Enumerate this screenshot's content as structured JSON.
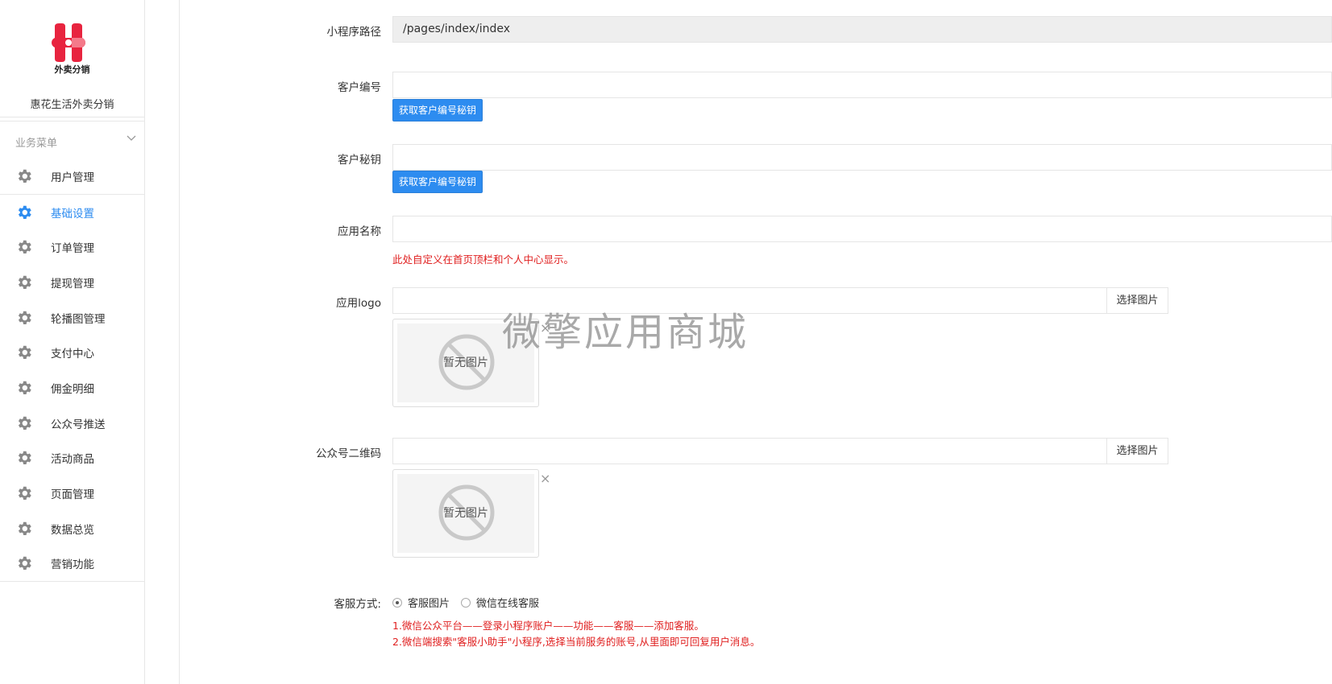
{
  "brand": {
    "logo_text": "外卖分销",
    "name": "惠花生活外卖分销",
    "logo_colors": [
      "#e8243f",
      "#f47a8a"
    ]
  },
  "menu": {
    "heading": "业务菜单",
    "items": [
      {
        "label": "用户管理",
        "icon": "gear-icon",
        "active": false
      },
      {
        "label": "基础设置",
        "icon": "gear-icon",
        "active": true
      },
      {
        "label": "订单管理",
        "icon": "gear-icon",
        "active": false
      },
      {
        "label": "提现管理",
        "icon": "gear-icon",
        "active": false
      },
      {
        "label": "轮播图管理",
        "icon": "gear-icon",
        "active": false
      },
      {
        "label": "支付中心",
        "icon": "gear-icon",
        "active": false
      },
      {
        "label": "佣金明细",
        "icon": "gear-icon",
        "active": false
      },
      {
        "label": "公众号推送",
        "icon": "gear-icon",
        "active": false
      },
      {
        "label": "活动商品",
        "icon": "gear-icon",
        "active": false
      },
      {
        "label": "页面管理",
        "icon": "gear-icon",
        "active": false
      },
      {
        "label": "数据总览",
        "icon": "gear-icon",
        "active": false
      },
      {
        "label": "营销功能",
        "icon": "gear-icon",
        "active": false
      }
    ]
  },
  "form": {
    "path": {
      "label": "小程序路径",
      "value": "/pages/index/index"
    },
    "client_id": {
      "label": "客户编号",
      "value": "",
      "button": "获取客户编号秘钥"
    },
    "client_secret": {
      "label": "客户秘钥",
      "value": "",
      "button": "获取客户编号秘钥"
    },
    "app_name": {
      "label": "应用名称",
      "value": "",
      "help": "此处自定义在首页顶栏和个人中心显示。"
    },
    "app_logo": {
      "label": "应用logo",
      "value": "",
      "pick_button": "选择图片",
      "placeholder_text": "暂无图片",
      "close": "×"
    },
    "qrcode": {
      "label": "公众号二维码",
      "value": "",
      "pick_button": "选择图片",
      "placeholder_text": "暂无图片",
      "close": "×"
    },
    "service": {
      "label": "客服方式:",
      "options": [
        {
          "label": "客服图片",
          "checked": true
        },
        {
          "label": "微信在线客服",
          "checked": false
        }
      ],
      "help": [
        "1.微信公众平台——登录小程序账户——功能——客服——添加客服。",
        "2.微信端搜索\"客服小助手\"小程序,选择当前服务的账号,从里面即可回复用户消息。"
      ]
    }
  },
  "watermark": "微擎应用商城",
  "colors": {
    "accent": "#2d8cf0",
    "danger": "#e02020",
    "icon_gray": "#888888"
  }
}
